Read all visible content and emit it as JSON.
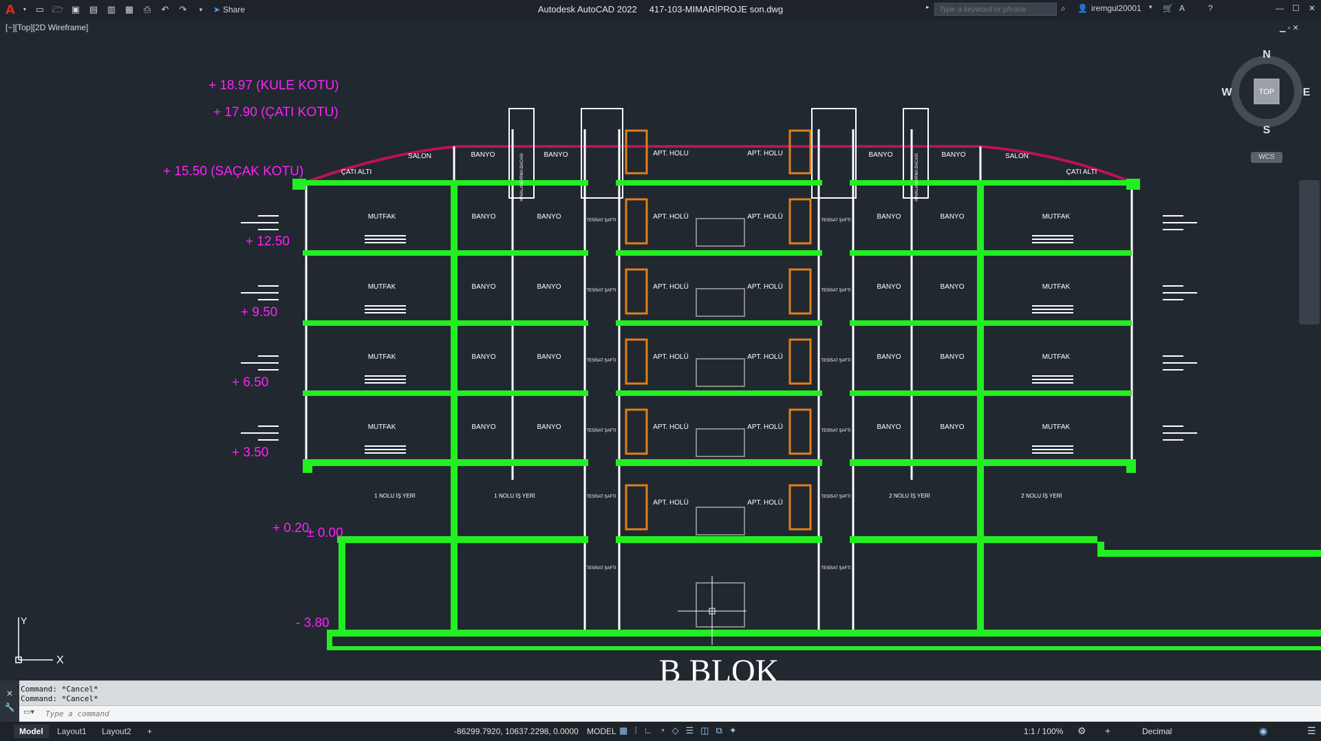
{
  "titlebar": {
    "app_title": "Autodesk AutoCAD 2022",
    "file_name": "417-103-MIMARİPROJE son.dwg",
    "share_label": "Share",
    "search_placeholder": "Type a keyword or phrase",
    "user": "iremgul20001"
  },
  "viewport": {
    "label": "[−][Top][2D Wireframe]",
    "ucs_x": "X",
    "ucs_y": "Y"
  },
  "viewcube": {
    "n": "N",
    "s": "S",
    "e": "E",
    "w": "W",
    "top": "TOP",
    "wcs": "WCS"
  },
  "elevations": [
    "+ 18.97 (KULE KOTU)",
    "+ 17.90 (ÇATI KOTU)",
    "+ 15.50 (SAÇAK KOTU)",
    "+ 12.50",
    "+ 9.50",
    "+ 6.50",
    "+ 3.50",
    "+ 0.20",
    "± 0.00",
    "- 3.80"
  ],
  "rooms": {
    "roof": [
      "ÇATI ALTI",
      "SALON",
      "BANYO",
      "BANYO",
      "APT. HOLU",
      "APT. HOLU",
      "BANYO",
      "BANYO",
      "SALON",
      "ÇATI ALTI"
    ],
    "floor_left": [
      "MUTFAK",
      "BANYO",
      "BANYO"
    ],
    "floor_center": [
      "APT. HOLÜ",
      "APT. HOLÜ"
    ],
    "floor_right": [
      "BANYO",
      "BANYO",
      "MUTFAK"
    ],
    "ground": [
      "1 NOLU İŞ YERİ",
      "1 NOLU İŞ YERİ",
      "APT. HOLÜ",
      "APT. HOLÜ",
      "2 NOLU İŞ YERİ",
      "2 NOLU İŞ YERİ"
    ],
    "shaft_label": "TESİSAT ŞAFTI",
    "vent_label": "HAVALANDIRMA BACASI"
  },
  "block_title": "B BLOK",
  "command": {
    "history": [
      "Command: *Cancel*",
      "Command: *Cancel*"
    ],
    "placeholder": "Type a command"
  },
  "status": {
    "tabs": [
      "Model",
      "Layout1",
      "Layout2"
    ],
    "add_tab": "+",
    "coords": "-86299.7920, 10637.2298, 0.0000",
    "space": "MODEL",
    "scale": "1:1 / 100%",
    "units": "Decimal"
  },
  "colors": {
    "background": "#212830",
    "slab": "#22ee22",
    "elevation_text": "#ff22ff",
    "roof_line": "#c0105a",
    "wall": "#ffffff",
    "door": "#e0801a"
  }
}
